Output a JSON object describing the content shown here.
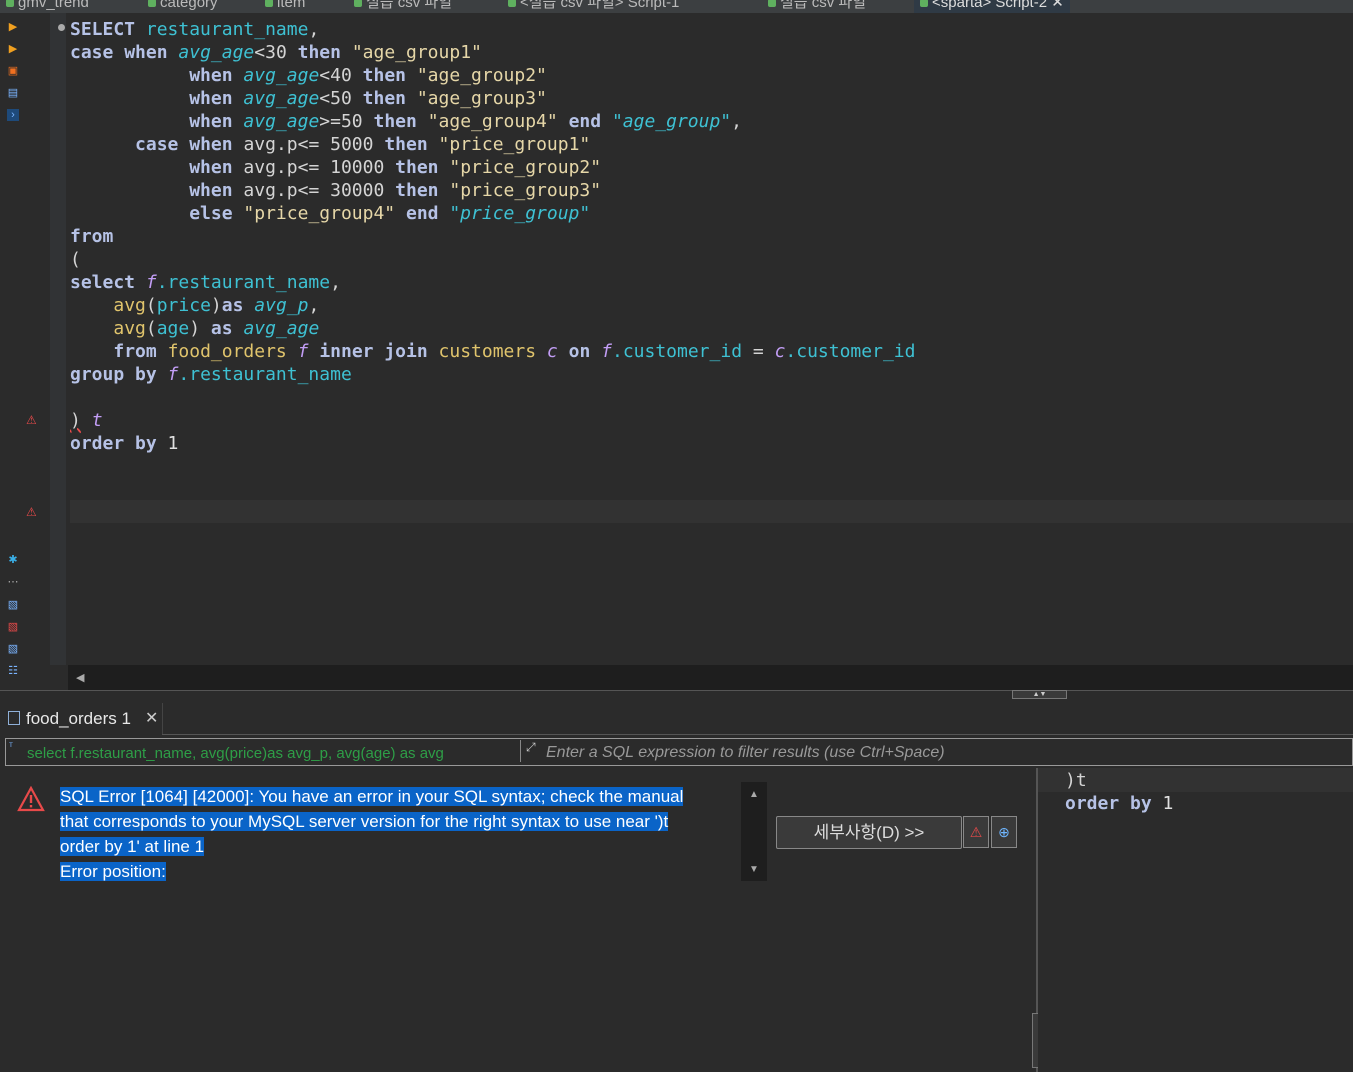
{
  "editor_tabs": [
    {
      "label": "gmv_trend"
    },
    {
      "label": "category"
    },
    {
      "label": "item"
    },
    {
      "label": "실습 csv 파일"
    },
    {
      "label": "<실습 csv 파일> Script-1"
    },
    {
      "label": "실습 csv 파일"
    },
    {
      "label": "<sparta> Script-2",
      "active": true
    }
  ],
  "code": {
    "l1_kw": "SELECT",
    "l1_f": "restaurant_name",
    "l1_p": ",",
    "l2_kw1": "case",
    "l2_kw2": "when",
    "l2_f": "avg_age",
    "l2_op": "<30",
    "l2_kw3": "then",
    "l2_s": "\"age_group1\"",
    "l3_kw1": "when",
    "l3_f": "avg_age",
    "l3_op": "<40",
    "l3_kw2": "then",
    "l3_s": "\"age_group2\"",
    "l4_kw1": "when",
    "l4_f": "avg_age",
    "l4_op": "<50",
    "l4_kw2": "then",
    "l4_s": "\"age_group3\"",
    "l5_kw1": "when",
    "l5_f": "avg_age",
    "l5_op": ">=50",
    "l5_kw2": "then",
    "l5_s": "\"age_group4\"",
    "l5_kw3": "end",
    "l5_a": "\"age_group\"",
    "l5_p": ",",
    "l6_kw1": "case",
    "l6_kw2": "when",
    "l6_t": "avg.p<= 5000",
    "l6_kw3": "then",
    "l6_s": "\"price_group1\"",
    "l7_kw1": "when",
    "l7_t": "avg.p<= 10000",
    "l7_kw2": "then",
    "l7_s": "\"price_group2\"",
    "l8_kw1": "when",
    "l8_t": "avg.p<= 30000",
    "l8_kw2": "then",
    "l8_s": "\"price_group3\"",
    "l9_kw1": "else",
    "l9_s": "\"price_group4\"",
    "l9_kw2": "end",
    "l9_a": "\"price_group\"",
    "l10_kw": "from",
    "l11_t": "(",
    "l12_kw": "select",
    "l12_al": "f",
    "l12_f": ".restaurant_name",
    "l12_p": ",",
    "l13_fn": "avg",
    "l13_o": "(",
    "l13_f": "price",
    "l13_c": ")",
    "l13_kw": "as",
    "l13_a": "avg_p",
    "l13_p": ",",
    "l14_fn": "avg",
    "l14_o": "(",
    "l14_f": "age",
    "l14_c": ")",
    "l14_kw": "as",
    "l14_a": "avg_age",
    "l15_kw1": "from",
    "l15_t1": "food_orders",
    "l15_al1": "f",
    "l15_kw2": "inner join",
    "l15_t2": "customers",
    "l15_al2": "c",
    "l15_kw3": "on",
    "l15_al3": "f",
    "l15_f1": ".customer_id",
    "l15_eq": "=",
    "l15_al4": "c",
    "l15_f2": ".customer_id",
    "l16_kw": "group by",
    "l16_al": "f",
    "l16_f": ".restaurant_name",
    "l18_t": ")",
    "l18_a": "t",
    "l19_kw": "order by",
    "l19_n": "1"
  },
  "results": {
    "tab_label": "food_orders 1",
    "filter_sql": "select f.restaurant_name, avg(price)as avg_p, avg(age) as avg",
    "filter_placeholder": "Enter a SQL expression to filter results (use Ctrl+Space)",
    "error_line1": "SQL Error [1064] [42000]: You have an error in your SQL syntax; check the manual",
    "error_line2": "that corresponds to your MySQL server version for the right syntax to use near ')t",
    "error_line3": "order by 1' at line 1",
    "error_line4": "Error position:",
    "details_button": "세부사항(D) >>",
    "side_line1": ")t",
    "side_line2_kw": "order by",
    "side_line2_n": "1"
  },
  "colors": {
    "accent": "#0a64c8",
    "error": "#e84a4a",
    "keyword": "#b6c2e6",
    "field": "#3ec1d3",
    "string": "#e6d7a8"
  }
}
